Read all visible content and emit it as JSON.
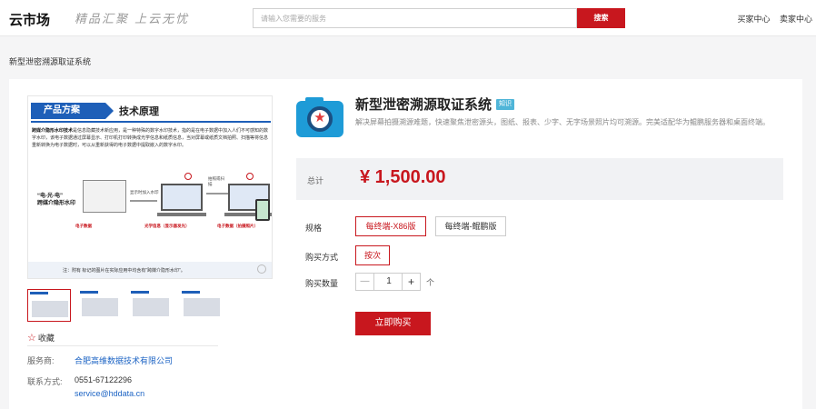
{
  "header": {
    "logo": "云市场",
    "slogan": "精品汇聚 上云无忧",
    "search_placeholder": "请输入您需要的服务",
    "search_button": "搜索",
    "buyer_center": "买家中心",
    "seller_center": "卖家中心"
  },
  "breadcrumb": "新型泄密溯源取证系统",
  "gallery": {
    "tag": "产品方案",
    "title": "技术原理",
    "text_bold": "跨媒介隐形水印技术",
    "text": "是信息隐藏技术新应用，是一种特殊的数字水印技术，指的是在电子数据中加入人们不可感知的数字水印，该电子数据通过屏幕显示、打印机打印转换成光学信息和纸质信息，当对屏幕或纸质文档拍照、扫描等将信息重新转换为电子数据时，可以从重新获得的电子数据中提取嵌入的数字水印。",
    "left_label_1": "“电-光-电”",
    "left_label_2": "跨媒介隐形水印",
    "caption_1": "显示时加入水印",
    "caption_2": "拍照或扫描",
    "bottom_1": "电子数据",
    "bottom_2": "光学信息（显示器发光）",
    "bottom_3": "电子数据（拍摄照片）",
    "footnote": "注：附有 标记的图片在实际应用中均含有“跨媒介隐形水印”。"
  },
  "favorite": "收藏",
  "provider": {
    "label": "服务商:",
    "value": "合肥高维数据技术有限公司"
  },
  "contact": {
    "label": "联系方式:",
    "phone": "0551-67122296",
    "email": "service@hddata.cn"
  },
  "product": {
    "title": "新型泄密溯源取证系统",
    "tag": "知识",
    "description": "解决屏幕拍摄溯源难题，快速聚焦泄密源头，图纸、报表、少字、无字场景照片均可溯源。完美适配华为鲲鹏服务器和桌面终端。"
  },
  "price": {
    "label": "总计",
    "value": "¥ 1,500.00"
  },
  "spec": {
    "label": "规格",
    "options": [
      "每终端-X86版",
      "每终端-鲲鹏版"
    ],
    "selected": 0
  },
  "purchase_mode": {
    "label": "购买方式",
    "options": [
      "按次"
    ]
  },
  "quantity": {
    "label": "购买数量",
    "minus": "—",
    "value": "1",
    "plus": "+",
    "unit": "个"
  },
  "buy_button": "立即购买",
  "colors": {
    "accent": "#c8171e",
    "link": "#1d64c4",
    "brand_blue": "#1e5fb8"
  }
}
